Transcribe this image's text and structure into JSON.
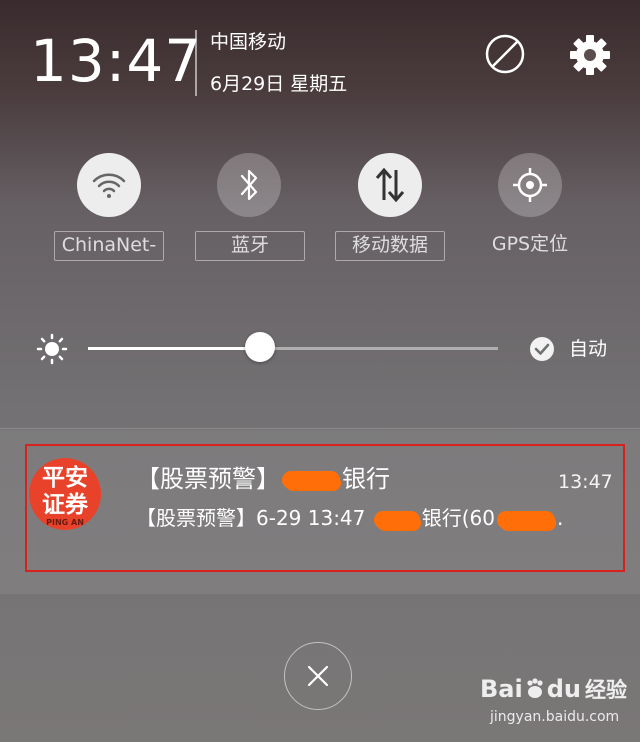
{
  "header": {
    "time": "13:47",
    "carrier": "中国移动",
    "date": "6月29日 星期五",
    "icons": [
      "do-not-disturb-icon",
      "gear-icon"
    ]
  },
  "toggles": [
    {
      "label": "ChinaNet-",
      "icon": "wifi-icon",
      "state": "on"
    },
    {
      "label": "蓝牙",
      "icon": "bluetooth-icon",
      "state": "off"
    },
    {
      "label": "移动数据",
      "icon": "mobile-data-icon",
      "state": "on"
    },
    {
      "label": "GPS定位",
      "icon": "gps-icon",
      "state": "off"
    }
  ],
  "brightness": {
    "level": 0.42,
    "auto_label": "自动",
    "auto_checked": true
  },
  "notification": {
    "app_icon_lines": [
      "平安",
      "证券",
      "PING AN"
    ],
    "title_prefix": "【股票预警】",
    "title_suffix": "银行",
    "time": "13:47",
    "body_prefix": "【股票预警】6-29 13:47 ",
    "body_middle": "银行(60",
    "body_suffix": "."
  },
  "watermark": {
    "brand_latin": "Bai",
    "brand_latin2": "du",
    "brand_cn": "经验",
    "url": "jingyan.baidu.com"
  },
  "colors": {
    "highlight_frame": "#d8201e",
    "app_icon_bg": "#e8432a",
    "redaction": "#ff6e08"
  }
}
